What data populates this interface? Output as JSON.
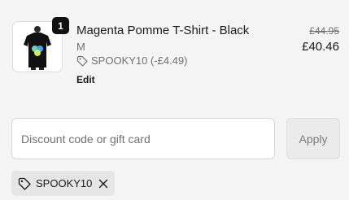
{
  "line_item": {
    "quantity": "1",
    "title": "Magenta Pomme T-Shirt - Black",
    "variant": "M",
    "discount": "SPOOKY10 (-£4.49)",
    "edit_label": "Edit",
    "original_price": "£44.95",
    "final_price": "£40.46",
    "image_icon": "tshirt-product-image"
  },
  "discount_form": {
    "placeholder": "Discount code or gift card",
    "value": "",
    "apply_label": "Apply"
  },
  "applied_code": {
    "code": "SPOOKY10",
    "tag_icon": "tag-icon",
    "remove_icon": "close-icon"
  }
}
